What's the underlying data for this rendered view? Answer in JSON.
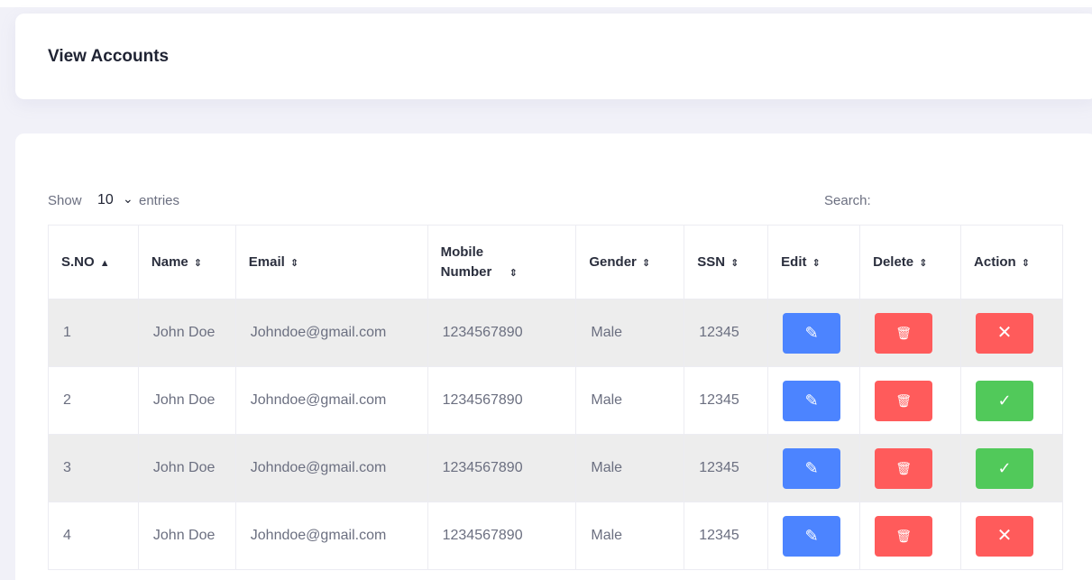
{
  "page": {
    "title": "View Accounts"
  },
  "toolbar": {
    "show_label": "Show",
    "entries_value": "10",
    "entries_label": "entries",
    "search_label": "Search:"
  },
  "table": {
    "headers": [
      {
        "label": "S.NO",
        "sort_icon": "▲"
      },
      {
        "label": "Name",
        "sort_icon": "⇕"
      },
      {
        "label": "Email",
        "sort_icon": "⇕"
      },
      {
        "label": "Mobile Number",
        "sort_icon": "⇕"
      },
      {
        "label": "Gender",
        "sort_icon": "⇕"
      },
      {
        "label": "SSN",
        "sort_icon": "⇕"
      },
      {
        "label": "Edit",
        "sort_icon": "⇕"
      },
      {
        "label": "Delete",
        "sort_icon": "⇕"
      },
      {
        "label": "Action",
        "sort_icon": "⇕"
      }
    ],
    "rows": [
      {
        "sno": "1",
        "name": "John Doe",
        "email": "Johndoe@gmail.com",
        "mobile": "1234567890",
        "gender": "Male",
        "ssn": "12345",
        "edit_icon": "✎",
        "delete_icon": "🗑",
        "action": "x",
        "action_icon": "✕"
      },
      {
        "sno": "2",
        "name": "John Doe",
        "email": "Johndoe@gmail.com",
        "mobile": "1234567890",
        "gender": "Male",
        "ssn": "12345",
        "edit_icon": "✎",
        "delete_icon": "🗑",
        "action": "check",
        "action_icon": "✓"
      },
      {
        "sno": "3",
        "name": "John Doe",
        "email": "Johndoe@gmail.com",
        "mobile": "1234567890",
        "gender": "Male",
        "ssn": "12345",
        "edit_icon": "✎",
        "delete_icon": "🗑",
        "action": "check",
        "action_icon": "✓"
      },
      {
        "sno": "4",
        "name": "John Doe",
        "email": "Johndoe@gmail.com",
        "mobile": "1234567890",
        "gender": "Male",
        "ssn": "12345",
        "edit_icon": "✎",
        "delete_icon": "🗑",
        "action": "x",
        "action_icon": "✕"
      }
    ]
  },
  "colors": {
    "edit": "#4c84ff",
    "delete": "#ff5b5b",
    "approve": "#51c95a",
    "reject": "#ff5b5b"
  }
}
